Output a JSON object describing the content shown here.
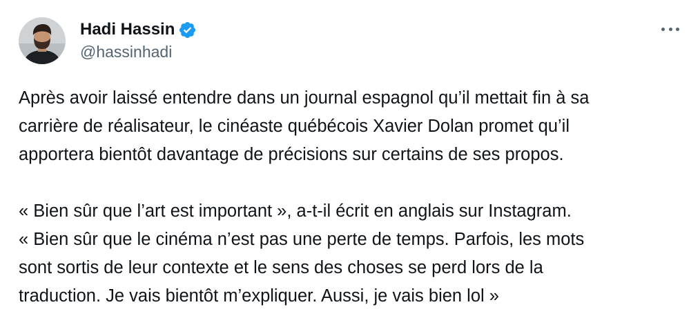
{
  "author": {
    "display_name": "Hadi Hassin",
    "handle": "@hassinhadi",
    "verified": true,
    "verified_color": "#1d9bf0",
    "avatar_icon": "profile-photo"
  },
  "more_icon": "ellipsis-icon",
  "tweet": {
    "paragraph_1": "Après avoir laissé entendre dans un journal espagnol qu’il mettait fin à sa\ncarrière de réalisateur, le cinéaste québécois Xavier Dolan promet qu’il\napportera bientôt davantage de précisions sur certains de ses propos.",
    "paragraph_2": "« Bien sûr que l’art est important », a-t-il écrit en anglais sur Instagram.\n« Bien sûr que le cinéma n’est pas une perte de temps. Parfois, les mots\nsont sortis de leur contexte et le sens des choses se perd lors de la\ntraduction. Je vais bientôt m’expliquer. Aussi, je vais bien lol »"
  }
}
